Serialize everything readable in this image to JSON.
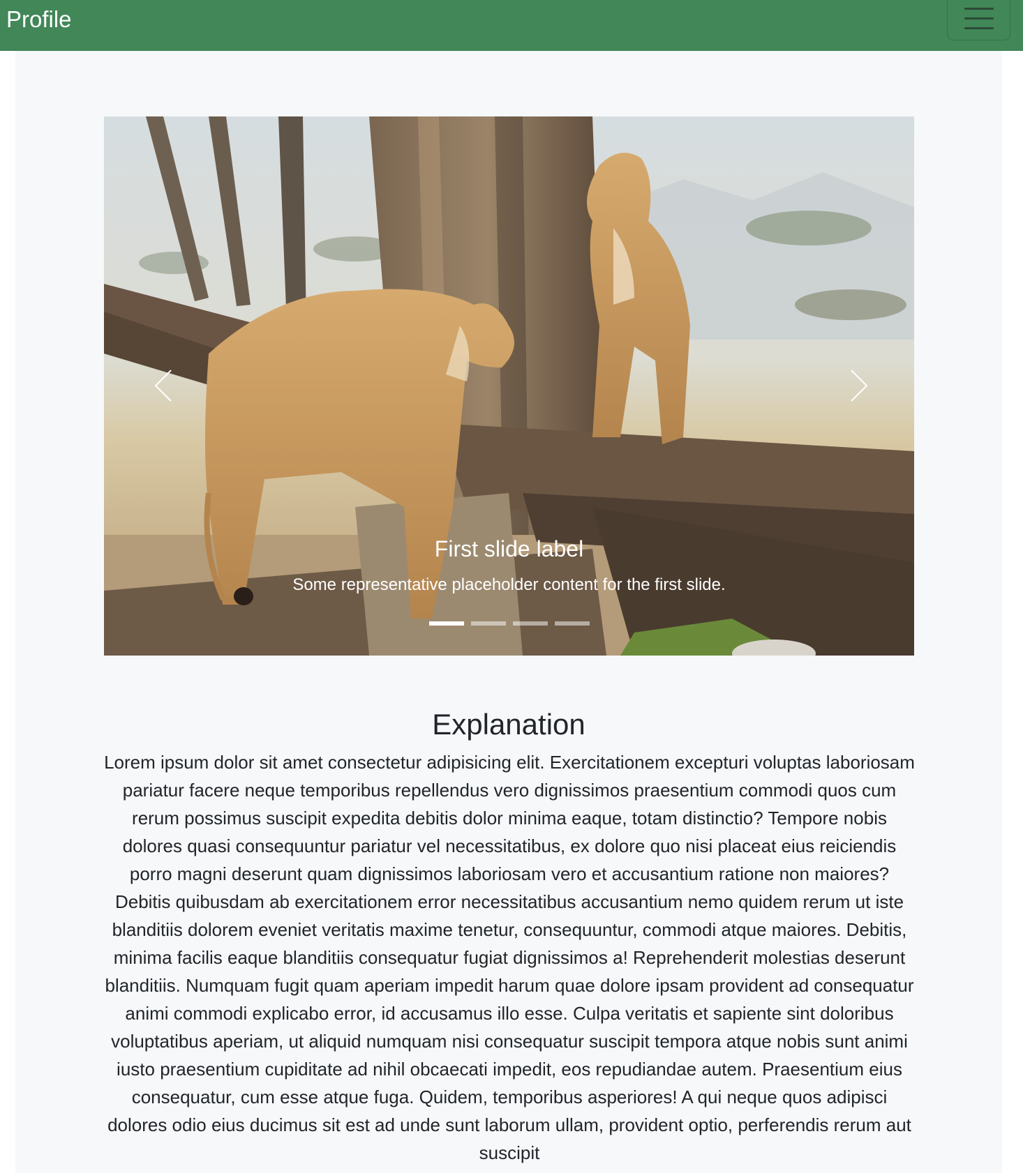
{
  "navbar": {
    "brand": "Profile",
    "menu_icon": "hamburger-menu-icon",
    "color": "#418758"
  },
  "carousel": {
    "slide_title": "First slide label",
    "slide_text": "Some representative placeholder content for the first slide.",
    "prev_icon": "chevron-left-icon",
    "next_icon": "chevron-right-icon",
    "slides_count": 4,
    "active_slide": 1,
    "image": "two lionesses standing on fallen tree logs"
  },
  "section": {
    "title": "Explanation",
    "body": "Lorem ipsum dolor sit amet consectetur adipisicing elit. Exercitationem excepturi voluptas laboriosam pariatur facere neque temporibus repellendus vero dignissimos praesentium commodi quos cum rerum possimus suscipit expedita debitis dolor minima eaque, totam distinctio? Tempore nobis dolores quasi consequuntur pariatur vel necessitatibus, ex dolore quo nisi placeat eius reiciendis porro magni deserunt quam dignissimos laboriosam vero et accusantium ratione non maiores? Debitis quibusdam ab exercitationem error necessitatibus accusantium nemo quidem rerum ut iste blanditiis dolorem eveniet veritatis maxime tenetur, consequuntur, commodi atque maiores. Debitis, minima facilis eaque blanditiis consequatur fugiat dignissimos a! Reprehenderit molestias deserunt blanditiis. Numquam fugit quam aperiam impedit harum quae dolore ipsam provident ad consequatur animi commodi explicabo error, id accusamus illo esse. Culpa veritatis et sapiente sint doloribus voluptatibus aperiam, ut aliquid numquam nisi consequatur suscipit tempora atque nobis sunt animi iusto praesentium cupiditate ad nihil obcaecati impedit, eos repudiandae autem. Praesentium eius consequatur, cum esse atque fuga. Quidem, temporibus asperiores! A qui neque quos adipisci dolores odio eius ducimus sit est ad unde sunt laborum ullam, provident optio, perferendis rerum aut suscipit"
  }
}
